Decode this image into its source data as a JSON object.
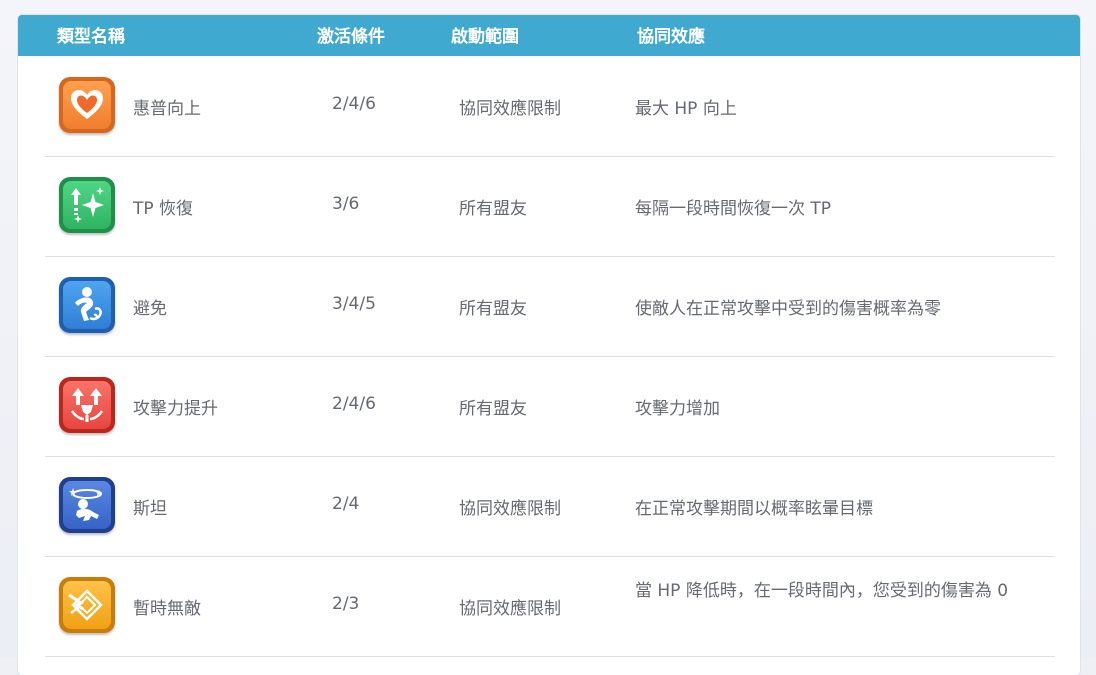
{
  "header": {
    "name": "類型名稱",
    "condition": "激活條件",
    "range": "啟動範圍",
    "effect": "協同效應"
  },
  "rows": [
    {
      "name": "惠普向上",
      "condition": "2/4/6",
      "range": "協同效應限制",
      "effect": "最大 HP 向上",
      "icon": "heart-up-icon",
      "color": "#f07f2e"
    },
    {
      "name": "TP 恢復",
      "condition": "3/6",
      "range": "所有盟友",
      "effect": "每隔一段時間恢復一次 TP",
      "icon": "sparkle-up-icon",
      "color": "#2fb562"
    },
    {
      "name": "避免",
      "condition": "3/4/5",
      "range": "所有盟友",
      "effect": "使敵人在正常攻擊中受到的傷害概率為零",
      "icon": "dodge-icon",
      "color": "#2f7fd6"
    },
    {
      "name": "攻擊力提升",
      "condition": "2/4/6",
      "range": "所有盟友",
      "effect": "攻擊力增加",
      "icon": "attack-up-icon",
      "color": "#e8463e"
    },
    {
      "name": "斯坦",
      "condition": "2/4",
      "range": "協同效應限制",
      "effect": "在正常攻擊期間以概率眩暈目標",
      "icon": "stun-icon",
      "color": "#3564c7"
    },
    {
      "name": "暫時無敵",
      "condition": "2/3",
      "range": "協同效應限制",
      "effect": "當 HP 降低時，在一段時間內，您受到的傷害為 0",
      "icon": "invincible-icon",
      "color": "#f0a014"
    }
  ]
}
